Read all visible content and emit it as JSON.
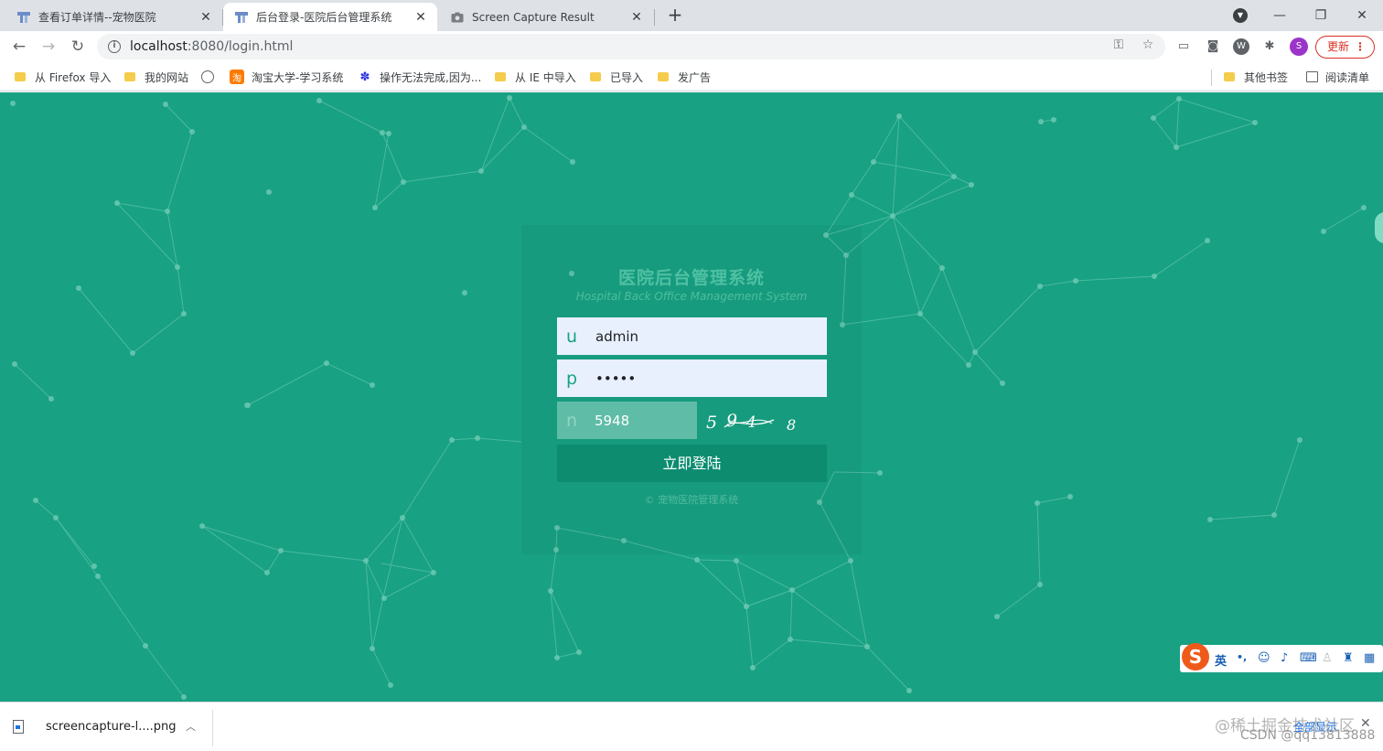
{
  "browser": {
    "tabs": [
      {
        "title": "查看订单详情--宠物医院",
        "active": false
      },
      {
        "title": "后台登录-医院后台管理系统",
        "active": true
      },
      {
        "title": "Screen Capture Result",
        "active": false
      }
    ],
    "new_tab_icon": "plus-icon",
    "url_host": "localhost",
    "url_path": ":8080/login.html",
    "profile_initial": "S",
    "update_label": "更新",
    "update_color": "#d93025"
  },
  "bookmarks": [
    {
      "label": "从 Firefox 导入",
      "icon": "folder-icon"
    },
    {
      "label": "我的网站",
      "icon": "folder-icon"
    },
    {
      "label": "",
      "icon": "globe-icon"
    },
    {
      "label": "淘宝大学-学习系统",
      "icon": "taobao-icon"
    },
    {
      "label": "操作无法完成,因为...",
      "icon": "baidu-paw-icon"
    },
    {
      "label": "从 IE 中导入",
      "icon": "folder-icon"
    },
    {
      "label": "已导入",
      "icon": "folder-icon"
    },
    {
      "label": "发广告",
      "icon": "folder-icon"
    }
  ],
  "bookmarks_right": [
    {
      "label": "其他书签",
      "icon": "folder-icon"
    },
    {
      "label": "阅读清单",
      "icon": "reading-list-icon"
    }
  ],
  "login": {
    "title": "医院后台管理系统",
    "subtitle": "Hospital Back Office Management System",
    "username_prefix": "u",
    "username_value": "admin",
    "password_prefix": "p",
    "password_value": "•••••",
    "captcha_prefix": "n",
    "captcha_value": "5948",
    "captcha_image_text": "5 9 4 8",
    "submit_label": "立即登陆",
    "copyright": "© 宠物医院管理系统",
    "brand_color": "#18a183",
    "button_color": "#0d8c70"
  },
  "ime": {
    "mode_label": "英",
    "punct_label": "•,"
  },
  "download": {
    "file_name": "screencapture-l....png"
  },
  "watermark": {
    "line1": "@稀土掘金技术社区",
    "show_all": "全部显示",
    "line2": "CSDN @qq13813888"
  }
}
